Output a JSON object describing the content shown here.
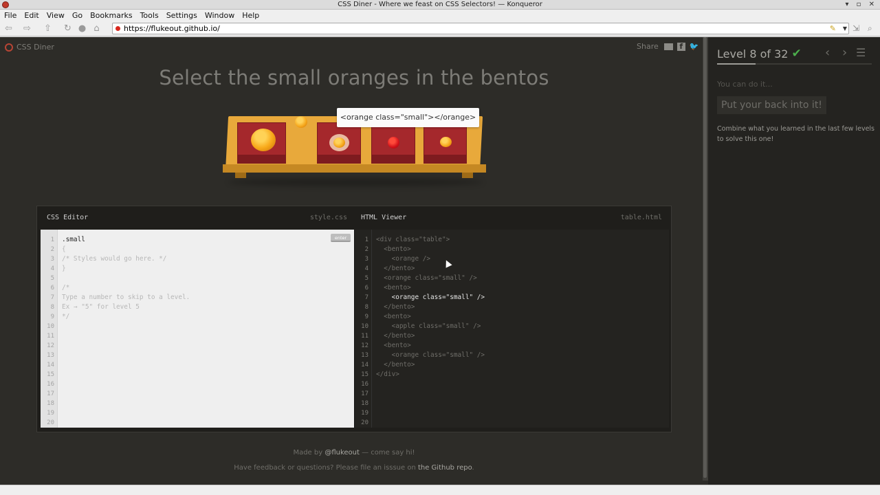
{
  "window": {
    "title": "CSS Diner - Where we feast on CSS Selectors! — Konqueror",
    "controls": "▾ ▫ ✕"
  },
  "menu": [
    "File",
    "Edit",
    "View",
    "Go",
    "Bookmarks",
    "Tools",
    "Settings",
    "Window",
    "Help"
  ],
  "nav": {
    "url": "https://flukeout.github.io/"
  },
  "page": {
    "brand": "CSS Diner",
    "share_label": "Share",
    "headline": "Select the small oranges in the bentos",
    "tooltip": "<orange class=\"small\"></orange>"
  },
  "editor": {
    "css_title": "CSS Editor",
    "css_file": "style.css",
    "html_title": "HTML Viewer",
    "html_file": "table.html",
    "enter_label": "enter",
    "css_lines": [
      ".small",
      "{",
      "/* Styles would go here. */",
      "}",
      "",
      "/*",
      "Type a number to skip to a level.",
      "Ex → \"5\" for level 5",
      "*/",
      "",
      "",
      "",
      "",
      "",
      "",
      "",
      "",
      "",
      "",
      ""
    ],
    "html_lines": [
      "<div class=\"table\">",
      "  <bento>",
      "    <orange />",
      "  </bento>",
      "  <orange class=\"small\" />",
      "  <bento>",
      "    <orange class=\"small\" />",
      "  </bento>",
      "  <bento>",
      "    <apple class=\"small\" />",
      "  </bento>",
      "  <bento>",
      "    <orange class=\"small\" />",
      "  </bento>",
      "</div>",
      "",
      "",
      "",
      "",
      ""
    ]
  },
  "footer": {
    "made_by_prefix": "Made by ",
    "made_by_link": "@flukeout",
    "made_by_suffix": " — come say hi!",
    "feedback_prefix": "Have feedback or questions? Please file an isssue on ",
    "feedback_link": "the Github repo",
    "feedback_suffix": "."
  },
  "sidebar": {
    "level_text": "Level 8 of 32",
    "level_progress": 0.25,
    "you_can": "You can do it...",
    "hint": "Put your back into it!",
    "description": "Combine what you learned in the last few levels to solve this one!"
  }
}
